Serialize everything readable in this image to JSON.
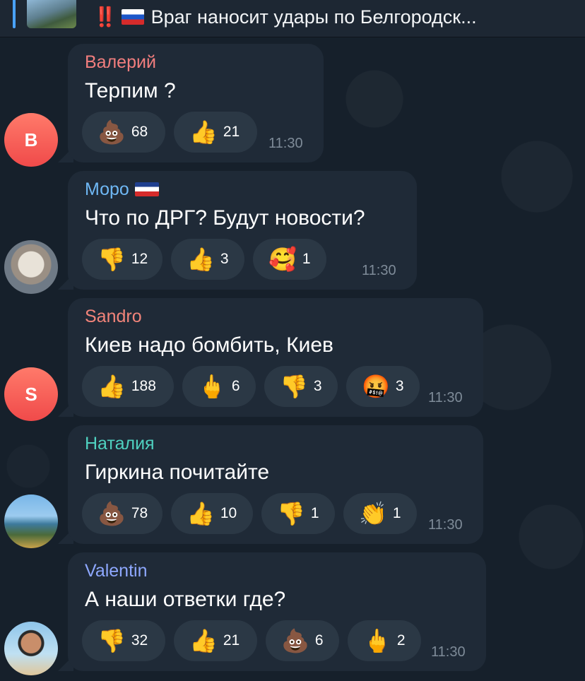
{
  "pinned": {
    "bang": "‼️",
    "title": "Враг наносит удары по Белгородск..."
  },
  "messages": [
    {
      "sender": "Валерий",
      "avatar_letter": "В",
      "text": "Терпим ?",
      "time": "11:30",
      "reactions": [
        {
          "icon": "poop-icon",
          "emoji": "💩",
          "count": "68"
        },
        {
          "icon": "thumbs-up-icon",
          "emoji": "👍",
          "count": "21"
        }
      ]
    },
    {
      "sender": "Моро",
      "avatar_letter": "",
      "text": "Что по ДРГ? Будут новости?",
      "time": "11:30",
      "reactions": [
        {
          "icon": "thumbs-down-icon",
          "emoji": "👎",
          "count": "12"
        },
        {
          "icon": "thumbs-up-icon",
          "emoji": "👍",
          "count": "3"
        },
        {
          "icon": "smiling-face-hearts-icon",
          "emoji": "🥰",
          "count": "1"
        }
      ]
    },
    {
      "sender": "Sandro",
      "avatar_letter": "S",
      "text": "Киев надо бомбить, Киев",
      "time": "11:30",
      "reactions": [
        {
          "icon": "thumbs-up-icon",
          "emoji": "👍",
          "count": "188"
        },
        {
          "icon": "middle-finger-icon",
          "emoji": "🖕",
          "count": "6"
        },
        {
          "icon": "thumbs-down-icon",
          "emoji": "👎",
          "count": "3"
        },
        {
          "icon": "cursing-face-icon",
          "emoji": "🤬",
          "count": "3"
        }
      ]
    },
    {
      "sender": "Наталия",
      "avatar_letter": "",
      "text": "Гиркина почитайте",
      "time": "11:30",
      "reactions": [
        {
          "icon": "poop-icon",
          "emoji": "💩",
          "count": "78"
        },
        {
          "icon": "thumbs-up-icon",
          "emoji": "👍",
          "count": "10"
        },
        {
          "icon": "thumbs-down-icon",
          "emoji": "👎",
          "count": "1"
        },
        {
          "icon": "clapping-hands-icon",
          "emoji": "👏",
          "count": "1"
        }
      ]
    },
    {
      "sender": "Valentin",
      "avatar_letter": "",
      "text": "А наши ответки где?",
      "time": "11:30",
      "reactions": [
        {
          "icon": "thumbs-down-icon",
          "emoji": "👎",
          "count": "32"
        },
        {
          "icon": "thumbs-up-icon",
          "emoji": "👍",
          "count": "21"
        },
        {
          "icon": "poop-icon",
          "emoji": "💩",
          "count": "6"
        },
        {
          "icon": "middle-finger-icon",
          "emoji": "🖕",
          "count": "2"
        }
      ]
    }
  ]
}
